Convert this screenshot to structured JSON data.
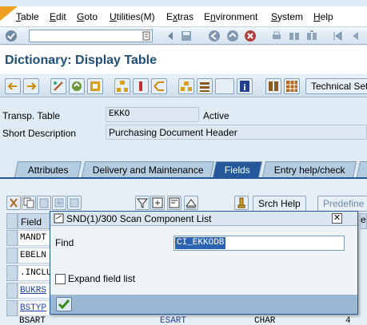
{
  "menu": {
    "items": [
      {
        "pre": "",
        "u": "T",
        "post": "able"
      },
      {
        "pre": "",
        "u": "E",
        "post": "dit"
      },
      {
        "pre": "",
        "u": "G",
        "post": "oto"
      },
      {
        "pre": "",
        "u": "U",
        "post": "tilities(M)"
      },
      {
        "pre": "E",
        "u": "x",
        "post": "tras"
      },
      {
        "pre": "E",
        "u": "n",
        "post": "vironment"
      },
      {
        "pre": "",
        "u": "S",
        "post": "ystem"
      },
      {
        "pre": "",
        "u": "H",
        "post": "elp"
      }
    ]
  },
  "page": {
    "title": "Dictionary: Display Table"
  },
  "toolbar": {
    "technical_settings_label": "Technical Set"
  },
  "header": {
    "table_label": "Transp. Table",
    "table_value": "EKKO",
    "status": "Active",
    "short_desc_label": "Short Description",
    "short_desc_value": "Purchasing Document Header"
  },
  "tabs": [
    "Attributes",
    "Delivery and Maintenance",
    "Fields",
    "Entry help/check"
  ],
  "active_tab": "Fields",
  "table_toolbar": {
    "srch_help_label": "Srch Help",
    "predefined_label": "Predefine"
  },
  "table": {
    "field_header": "Field",
    "rows": [
      "MANDT",
      "EBELN",
      ".INCLU",
      "BUKRS",
      "BSTYP",
      "BSART"
    ],
    "bottom_row": {
      "field": "BSART",
      "data_element": "ESART",
      "type": "CHAR",
      "length": "4"
    }
  },
  "dialog": {
    "title": "SND(1)/300 Scan Component List",
    "find_label": "Find",
    "find_value": "CI_EKKODB",
    "expand_label": "Expand field list"
  },
  "colors": {
    "accent": "#24589a",
    "title": "#1f4e79",
    "link": "#1f3fa8"
  }
}
